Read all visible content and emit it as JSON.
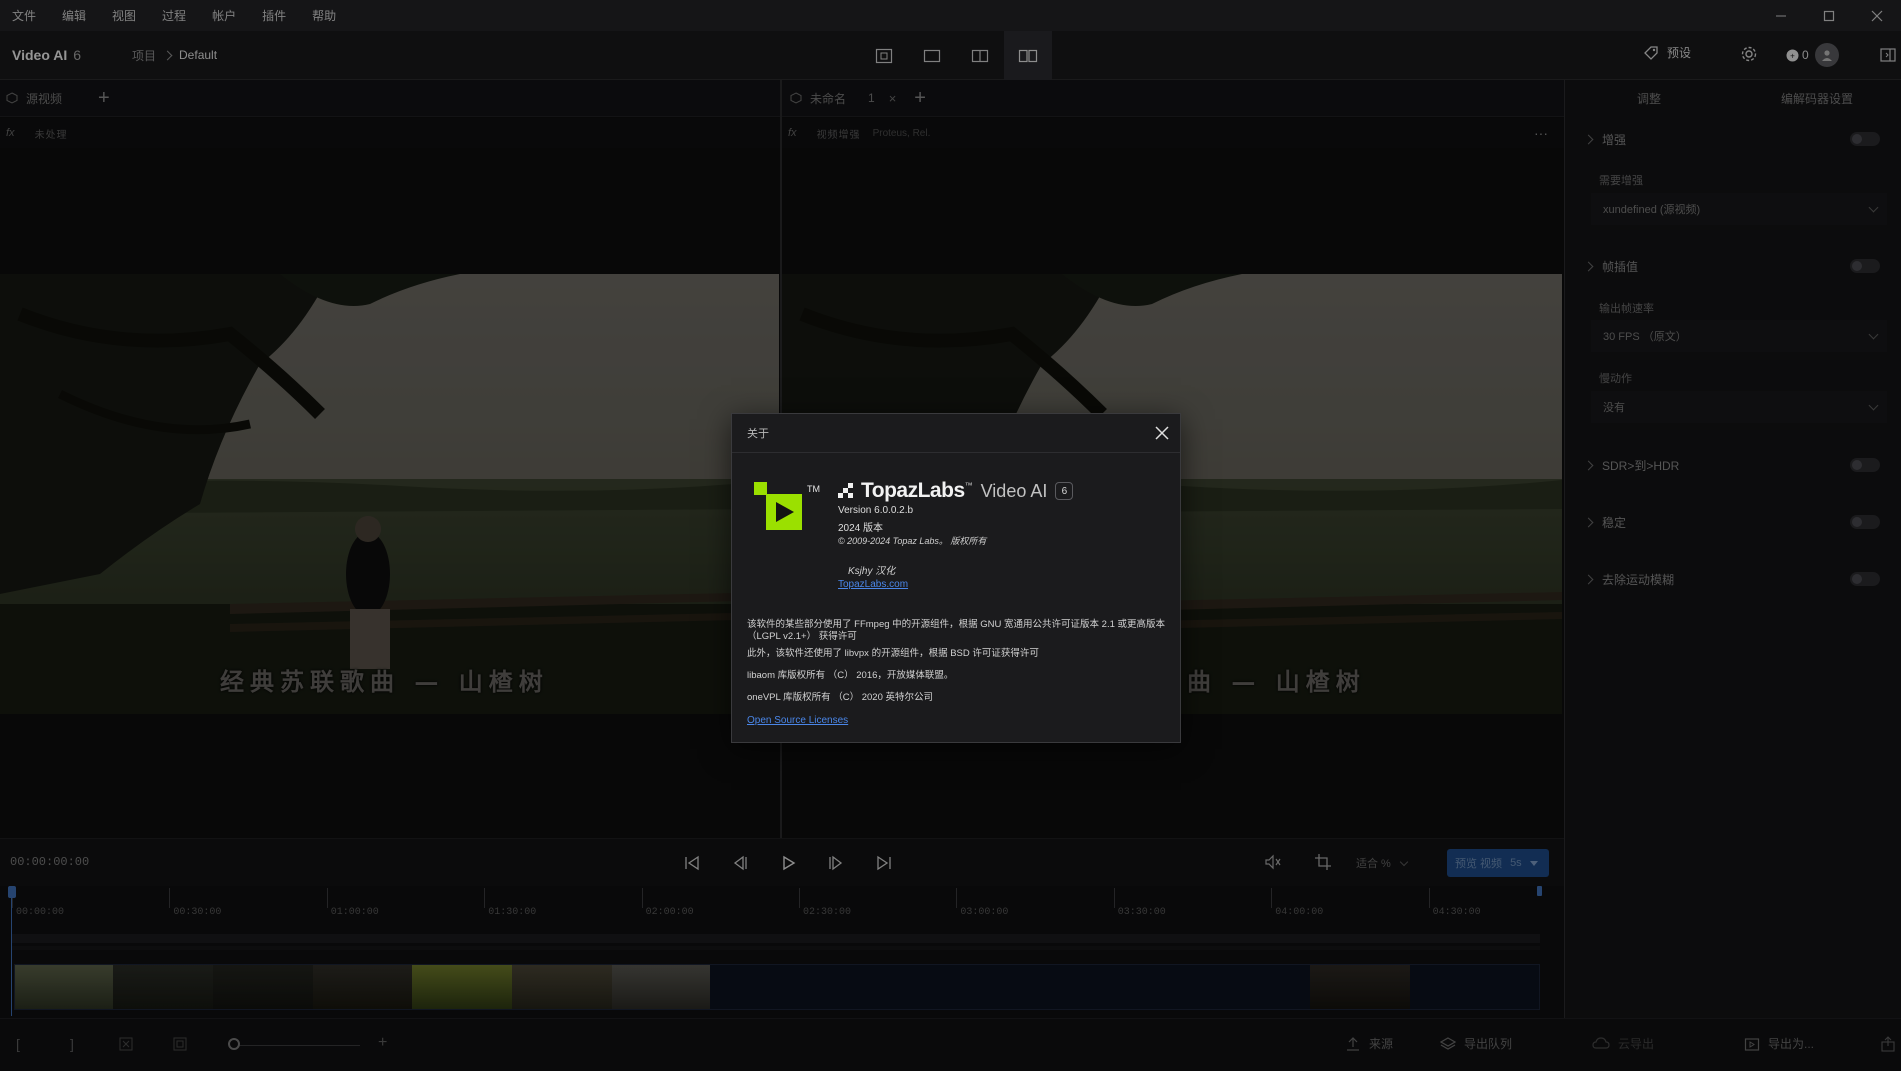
{
  "menu": [
    "文件",
    "编辑",
    "视图",
    "过程",
    "帐户",
    "插件",
    "帮助"
  ],
  "app": {
    "title": "Video AI",
    "version": "6"
  },
  "breadcrumb": {
    "project": "项目",
    "current": "Default"
  },
  "header": {
    "preset_label": "预设",
    "credits": "0"
  },
  "left_pane": {
    "tab_label": "源视频",
    "sub_label": "未处理"
  },
  "right_pane": {
    "tab_label": "未命名",
    "tab_number": "1",
    "sub_label": "视频增强",
    "sub_model": "Proteus, Rel."
  },
  "video": {
    "subtitle": "经典苏联歌曲 — 山楂树",
    "subtitle_right": "曲 — 山楂树"
  },
  "sidebar": {
    "tabs": [
      "调整",
      "编解码器设置"
    ],
    "enhance": {
      "title": "增强",
      "field_label": "需要增强",
      "field_value": "xundefined (源视频)"
    },
    "frame_interp": {
      "title": "帧插值",
      "fps_label": "输出帧速率",
      "fps_value": "30 FPS （原文）",
      "slowmo_label": "慢动作",
      "slowmo_value": "没有"
    },
    "sdr_hdr": {
      "title": "SDR>到>HDR"
    },
    "stabilize": {
      "title": "稳定"
    },
    "motion_blur": {
      "title": "去除运动模糊"
    }
  },
  "transport": {
    "timecode": "00:00:00:00",
    "zoom_label": "适合 %",
    "preview_label": "预览 视频",
    "preview_duration": "5s"
  },
  "timeline": {
    "ticks": [
      "00:00:00",
      "00:30:00",
      "01:00:00",
      "01:30:00",
      "02:00:00",
      "02:30:00",
      "03:00:00",
      "03:30:00",
      "04:00:00",
      "04:30:00"
    ]
  },
  "bottom": {
    "source_label": "来源",
    "queue_label": "导出队列",
    "cloud_label": "云导出",
    "export_label": "导出为..."
  },
  "about": {
    "title": "关于",
    "brand": "TopazLabs",
    "product": "Video AI",
    "badge": "6",
    "version": "Version 6.0.0.2.b",
    "year": "2024 版本",
    "copyright": "© 2009-2024 Topaz Labs。 版权所有",
    "localizer": "Ksjhy 汉化",
    "site": "TopazLabs.com",
    "license_1": "该软件的某些部分使用了 FFmpeg 中的开源组件，根据 GNU 宽通用公共许可证版本 2.1 或更高版本 （LGPL v2.1+） 获得许可",
    "license_2": "此外，该软件还使用了 libvpx 的开源组件，根据 BSD 许可证获得许可",
    "license_3": "libaom 库版权所有 （C） 2016，开放媒体联盟。",
    "license_4": "oneVPL 库版权所有 （C） 2020 英特尔公司",
    "oss": "Open Source Licenses"
  },
  "colors": {
    "accent": "#3e6fb5",
    "brand_green": "#9be000",
    "link": "#4a86e8"
  }
}
